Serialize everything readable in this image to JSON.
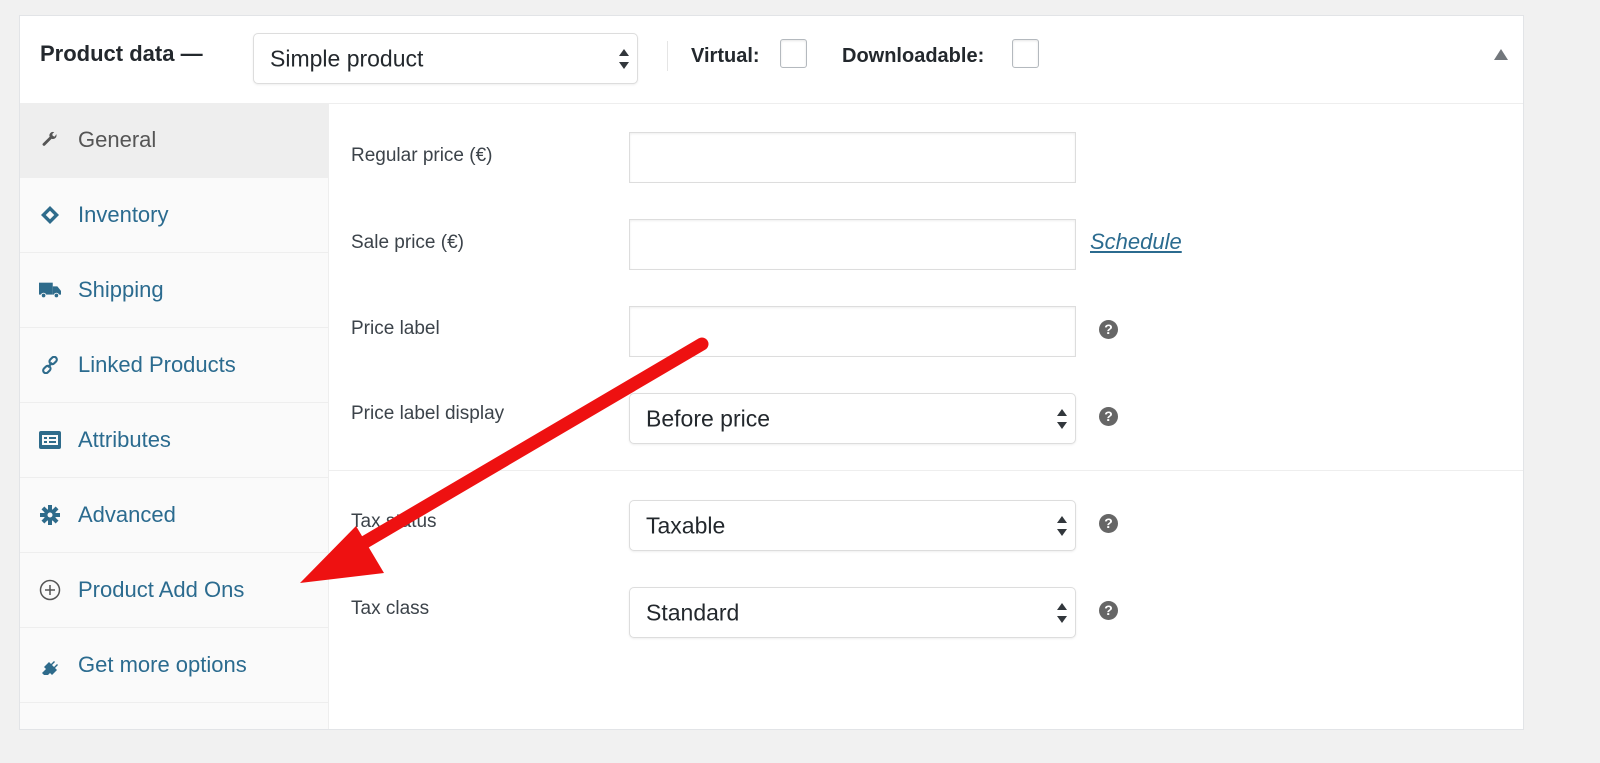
{
  "header": {
    "title": "Product data —",
    "product_type": "Simple product",
    "virtual_label": "Virtual:",
    "virtual_checked": false,
    "downloadable_label": "Downloadable:",
    "downloadable_checked": false,
    "collapse_icon": "triangle-up-icon"
  },
  "sidebar": {
    "active": "General",
    "items": [
      {
        "label": "General",
        "icon": "wrench-icon"
      },
      {
        "label": "Inventory",
        "icon": "tag-icon"
      },
      {
        "label": "Shipping",
        "icon": "truck-icon"
      },
      {
        "label": "Linked Products",
        "icon": "link-icon"
      },
      {
        "label": "Attributes",
        "icon": "list-card-icon"
      },
      {
        "label": "Advanced",
        "icon": "gear-icon"
      },
      {
        "label": "Product Add Ons",
        "icon": "plus-circle-icon"
      },
      {
        "label": "Get more options",
        "icon": "plugin-icon"
      }
    ]
  },
  "general": {
    "regular_price": {
      "label": "Regular price (€)",
      "value": ""
    },
    "sale_price": {
      "label": "Sale price (€)",
      "value": "",
      "schedule_link": "Schedule"
    },
    "price_label": {
      "label": "Price label",
      "value": "",
      "help": "?"
    },
    "price_label_display": {
      "label": "Price label display",
      "value": "Before price",
      "help": "?"
    },
    "tax_status": {
      "label": "Tax status",
      "value": "Taxable",
      "help": "?"
    },
    "tax_class": {
      "label": "Tax class",
      "value": "Standard",
      "help": "?"
    }
  },
  "annotation": {
    "type": "red-arrow",
    "color": "#ee1111",
    "points_to": "Product Add Ons"
  },
  "colors": {
    "link": "#2b6b8f",
    "background": "#f1f1f1",
    "panel": "#ffffff"
  }
}
